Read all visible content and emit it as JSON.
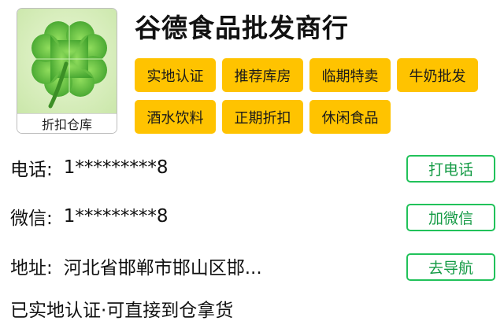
{
  "shop": {
    "name": "谷德食品批发商行",
    "logo_caption": "折扣仓库",
    "logo_icon": "four-leaf-clover-icon"
  },
  "tags": [
    "实地认证",
    "推荐库房",
    "临期特卖",
    "牛奶批发",
    "酒水饮料",
    "正期折扣",
    "休闲食品"
  ],
  "contact": {
    "phone": {
      "label": "电话:",
      "value": "1*********8",
      "button": "打电话"
    },
    "wechat": {
      "label": "微信:",
      "value": "1*********8",
      "button": "加微信"
    },
    "address": {
      "label": "地址:",
      "value": "河北省邯郸市邯山区邯...",
      "button": "去导航"
    }
  },
  "note": "已实地认证·可直接到仓拿货",
  "colors": {
    "tag_bg": "#ffc300",
    "button_border": "#21c25a",
    "button_text": "#139a44",
    "clover": "#5cc23c"
  }
}
